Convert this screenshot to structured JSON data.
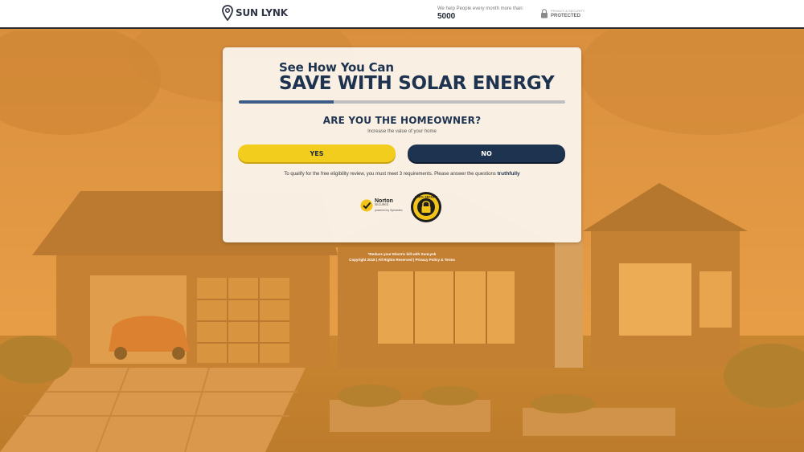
{
  "header": {
    "brand": "SUN LYNK",
    "help_label": "We help People every month more than:",
    "help_count": "5000",
    "privacy_line1": "PRIVACY & SECURITY",
    "privacy_line2": "PROTECTED"
  },
  "form": {
    "headline_small": "See How You Can",
    "headline_big": "SAVE WITH SOLAR ENERGY",
    "progress_fraction": 0.29,
    "question": "ARE YOU THE HOMEOWNER?",
    "subtitle": "Increase the value of your home",
    "yes_label": "YES",
    "no_label": "NO",
    "qualify_text": "To qualify for the free eligibility review, you must meet 3 requirements. Please answer the questions",
    "qualify_emphasis": "truthfully"
  },
  "badges": {
    "norton_title": "Norton",
    "norton_sub": "SECURED",
    "norton_powered": "powered by Symantec",
    "seal_text": "100% SECURE"
  },
  "footer": {
    "line1": "*Reduce your Electric bill with SunLynk",
    "line2": "Copyright 2018 | All Rights Reserved | Privacy Policy & Terms"
  },
  "colors": {
    "navy": "#1e3350",
    "yellow": "#f2cd1d",
    "overlay_orange": "#e89834"
  },
  "icons": {
    "brand": "map-pin-icon",
    "privacy": "lock-icon",
    "norton": "checkmark-icon",
    "seal": "lock-seal-icon"
  }
}
